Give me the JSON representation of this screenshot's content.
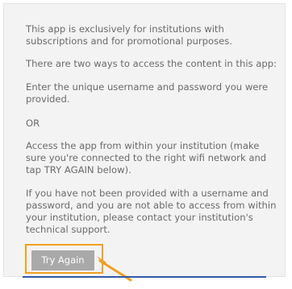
{
  "notice": {
    "paragraph_1": "This app is exclusively for institutions with subscriptions and for promotional purposes.",
    "paragraph_2": "There are two ways to access the content in this app:",
    "paragraph_3": "Enter the unique username and password you were provided.",
    "paragraph_4": "OR",
    "paragraph_5": "Access the app from within your institution (make sure you're connected to the right wifi network and tap TRY AGAIN below).",
    "paragraph_6": "If you have not been provided with a username and password, and you are not able to access from within your institution, please contact your institution's technical support."
  },
  "actions": {
    "try_again_label": "Try Again"
  },
  "colors": {
    "highlight": "#f0a020",
    "button_bg": "#a9a9a9",
    "text": "#6b6b6b",
    "accent_line": "#2f5aa8"
  },
  "icons": {
    "pointer": "arrow-pointer-icon"
  }
}
